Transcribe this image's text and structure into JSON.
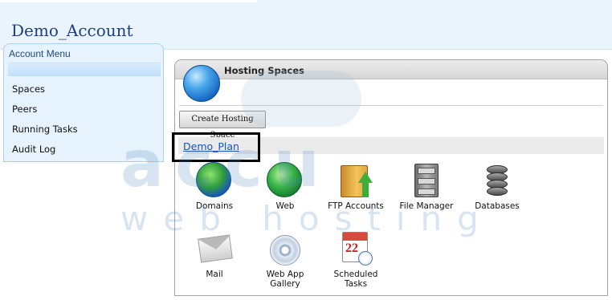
{
  "account": {
    "title": "Demo_Account"
  },
  "account_menu": {
    "header": "Account Menu",
    "items": [
      {
        "label": "Spaces"
      },
      {
        "label": "Peers"
      },
      {
        "label": "Running Tasks"
      },
      {
        "label": "Audit Log"
      }
    ]
  },
  "hosting_spaces": {
    "title": "Hosting Spaces",
    "create_button": "Create Hosting Space",
    "plan_link": "Demo_Plan",
    "tiles": [
      {
        "label": "Domains",
        "icon": "globe-icon"
      },
      {
        "label": "Web",
        "icon": "web-globe-icon"
      },
      {
        "label": "FTP Accounts",
        "icon": "folder-upload-icon"
      },
      {
        "label": "File Manager",
        "icon": "file-cabinet-icon"
      },
      {
        "label": "Databases",
        "icon": "database-icon"
      },
      {
        "label": "Mail",
        "icon": "envelope-icon"
      },
      {
        "label": "Web App Gallery",
        "icon": "disc-icon"
      },
      {
        "label": "Scheduled Tasks",
        "icon": "calendar-clock-icon"
      }
    ],
    "calendar_day": "22"
  },
  "watermark": {
    "brand": "accu",
    "tagline": "web hosting"
  },
  "colors": {
    "link": "#1b54b4",
    "title": "#1f3f7f",
    "menu_bg": "#e6f2fc"
  }
}
